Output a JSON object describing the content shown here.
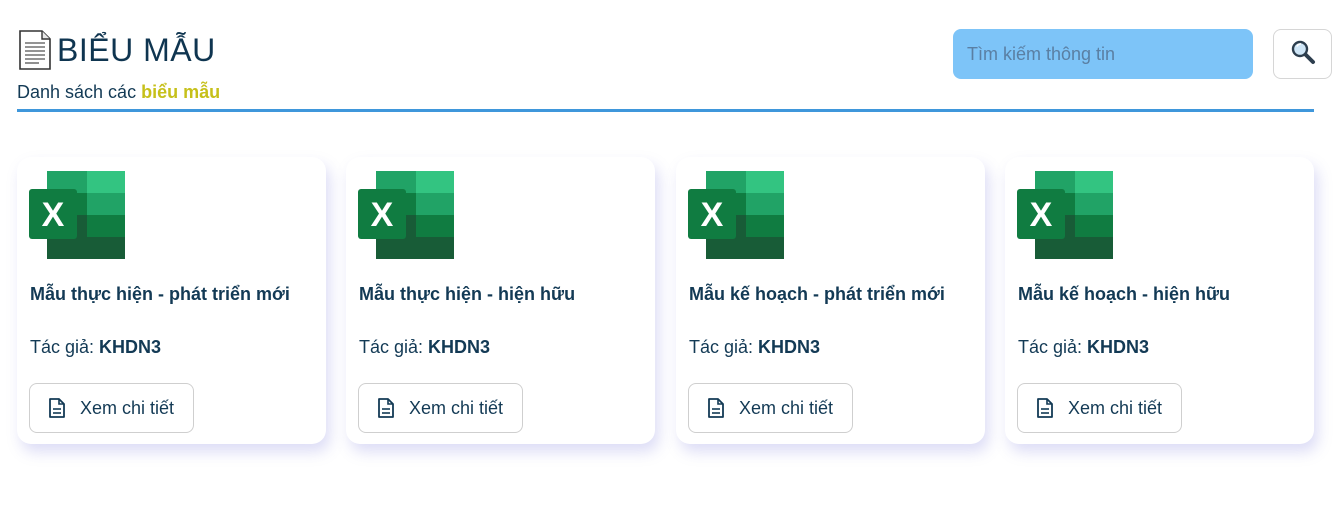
{
  "header": {
    "title": "BIỂU MẪU",
    "subtitle_prefix": "Danh sách các",
    "subtitle_highlight": "biểu mẫu",
    "search_placeholder": "Tìm kiếm thông tin",
    "search_icon": "magnifier-icon",
    "title_icon": "document-icon"
  },
  "colors": {
    "accent_rule": "#3f97db",
    "search_bg": "#7dc4f8",
    "highlight": "#c6c01a",
    "text": "#133a55"
  },
  "cards": [
    {
      "icon": "excel-icon",
      "title": "Mẫu thực hiện - phát triển mới",
      "author_label": "Tác giả:",
      "author": "KHDN3",
      "button": "Xem chi tiết"
    },
    {
      "icon": "excel-icon",
      "title": "Mẫu thực hiện - hiện hữu",
      "author_label": "Tác giả:",
      "author": "KHDN3",
      "button": "Xem chi tiết"
    },
    {
      "icon": "excel-icon",
      "title": "Mẫu kế hoạch - phát triển mới",
      "author_label": "Tác giả:",
      "author": "KHDN3",
      "button": "Xem chi tiết"
    },
    {
      "icon": "excel-icon",
      "title": "Mẫu kế hoạch - hiện hữu",
      "author_label": "Tác giả:",
      "author": "KHDN3",
      "button": "Xem chi tiết"
    }
  ]
}
